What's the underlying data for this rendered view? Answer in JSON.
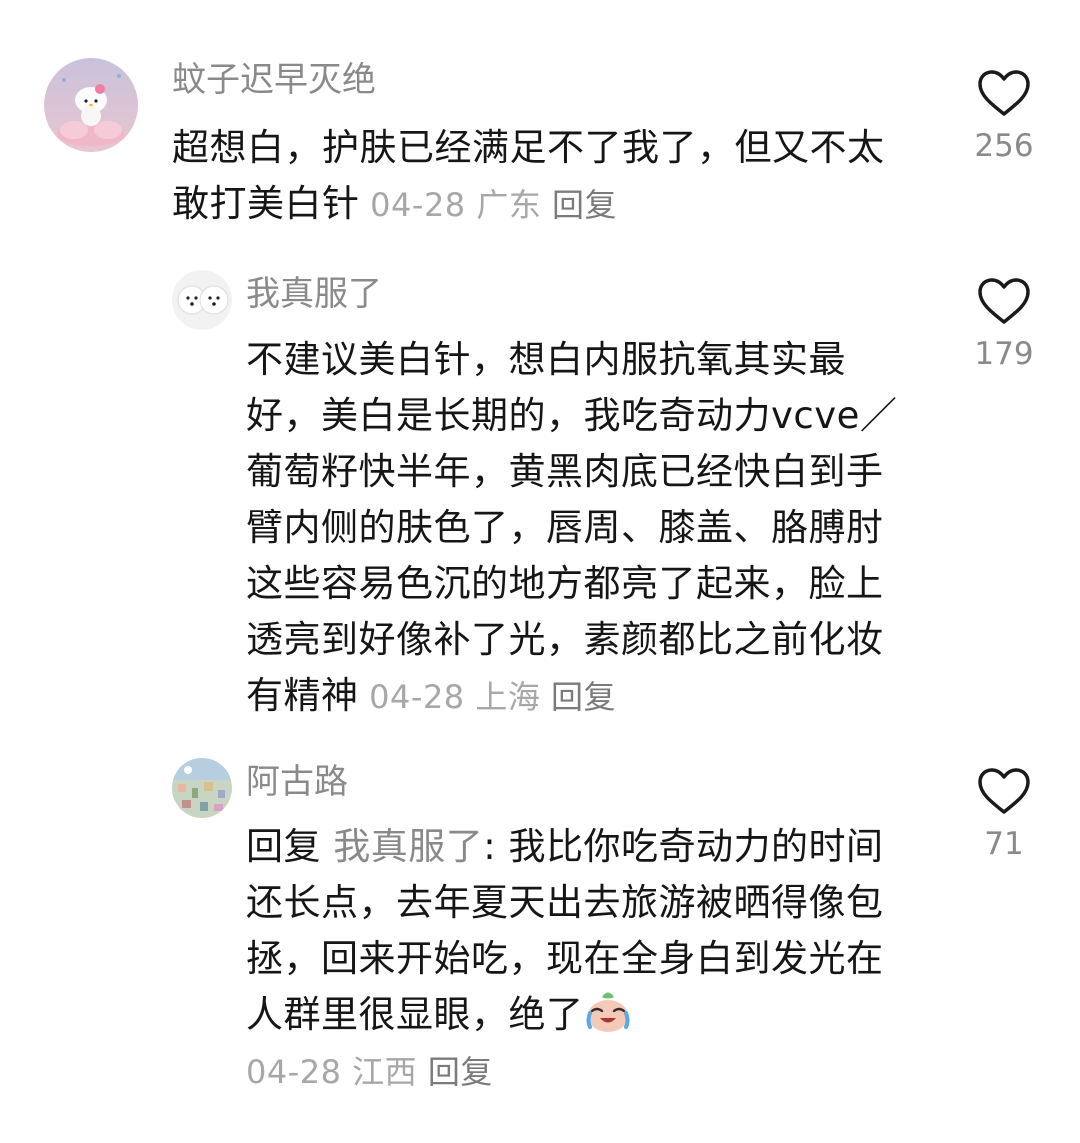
{
  "comments": [
    {
      "username": "蚊子迟早灭绝",
      "text": "超想白，护肤已经满足不了我了，但又不太敢打美白针",
      "date": "04-28",
      "location": "广东",
      "reply_label": "回复",
      "likes": "256",
      "avatar_icon": "hello-kitty-avatar"
    },
    {
      "username": "我真服了",
      "text": "不建议美白针，想白内服抗氧其实最好，美白是长期的，我吃奇动力vcve／葡萄籽快半年，黄黑肉底已经快白到手臂内侧的肤色了，唇周、膝盖、胳膊肘这些容易色沉的地方都亮了起来，脸上透亮到好像补了光，素颜都比之前化妆有精神",
      "date": "04-28",
      "location": "上海",
      "reply_label": "回复",
      "likes": "179",
      "avatar_icon": "white-dogs-avatar"
    },
    {
      "username": "阿古路",
      "reply_prefix": "回复",
      "mention": "我真服了",
      "colon": ":",
      "text": "我比你吃奇动力的时间还长点，去年夏天出去旅游被晒得像包拯，回来开始吃，现在全身白到发光在人群里很显眼，绝了",
      "emoji": "crying-laughing-emoji",
      "date": "04-28",
      "location": "江西",
      "reply_label": "回复",
      "likes": "71",
      "avatar_icon": "illustration-crowd-avatar"
    }
  ],
  "colors": {
    "text_primary": "#161616",
    "text_secondary": "#8a8a8a",
    "meta_gray": "#a7a7a7"
  }
}
